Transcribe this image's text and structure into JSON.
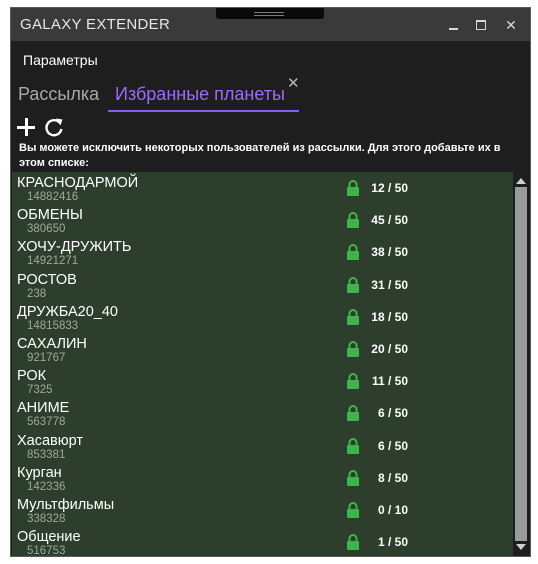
{
  "app": {
    "title": "GALAXY EXTENDER"
  },
  "window_controls": [
    "minimize-icon",
    "maximize-icon",
    "close-icon"
  ],
  "menu": {
    "label": "Параметры"
  },
  "tabs": [
    {
      "label": "Рассылка",
      "active": false
    },
    {
      "label": "Избранные планеты",
      "active": true
    }
  ],
  "toolbar": {
    "icons": [
      "plus-icon",
      "refresh-icon"
    ]
  },
  "info_text": "Вы можете исключить некоторых пользователей из рассылки. Для этого добавьте их в этом списке:",
  "colors": {
    "accent": "#8a5cf0",
    "list_bg": "#2d3e2d",
    "lock": "#3cb54a",
    "window_bg": "#1e1e1e",
    "titlebar": "#3a3a3a"
  },
  "planets": [
    {
      "name": "КРАСНОДАРМОЙ",
      "id": "14882416",
      "count": "12 / 50"
    },
    {
      "name": "ОБМЕНЫ",
      "id": "380650",
      "count": "45 / 50"
    },
    {
      "name": "ХОЧУ-ДРУЖИТЬ",
      "id": "14921271",
      "count": "38 / 50"
    },
    {
      "name": "РОСТОВ",
      "id": "238",
      "count": "31 / 50"
    },
    {
      "name": "ДРУЖБА20_40",
      "id": "14815833",
      "count": "18 / 50"
    },
    {
      "name": "САХАЛИН",
      "id": "921767",
      "count": "20 / 50"
    },
    {
      "name": "РОК",
      "id": "7325",
      "count": "11 / 50"
    },
    {
      "name": "АНИМЕ",
      "id": "563778",
      "count": "6 / 50"
    },
    {
      "name": "Хасавюрт",
      "id": "853381",
      "count": "6 / 50"
    },
    {
      "name": "Курган",
      "id": "142336",
      "count": "8 / 50"
    },
    {
      "name": "Мультфильмы",
      "id": "338328",
      "count": "0 / 10"
    },
    {
      "name": "Общение",
      "id": "516753",
      "count": "1 / 50"
    }
  ]
}
